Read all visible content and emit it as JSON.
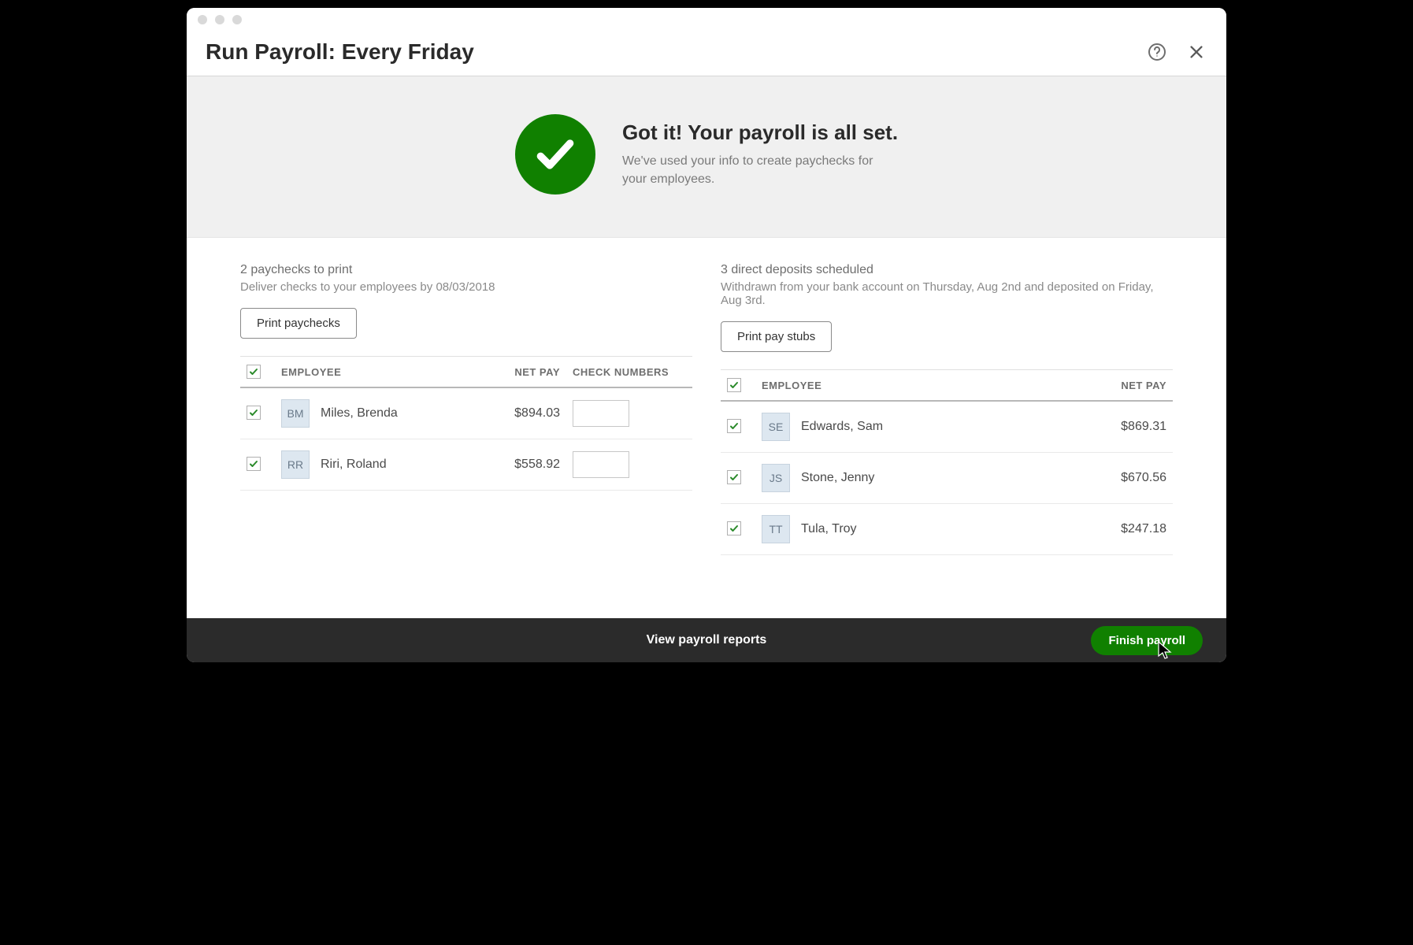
{
  "header": {
    "title": "Run Payroll: Every Friday"
  },
  "hero": {
    "heading": "Got it! Your payroll is all set.",
    "sub": "We've used your info to create paychecks for your employees."
  },
  "left": {
    "title": "2 paychecks to print",
    "sub": "Deliver checks to your employees by 08/03/2018",
    "button": "Print paychecks",
    "columns": {
      "employee": "EMPLOYEE",
      "netpay": "NET PAY",
      "checknums": "CHECK NUMBERS"
    },
    "rows": [
      {
        "initials": "BM",
        "name": "Miles, Brenda",
        "netpay": "$894.03",
        "checknum": ""
      },
      {
        "initials": "RR",
        "name": "Riri, Roland",
        "netpay": "$558.92",
        "checknum": ""
      }
    ]
  },
  "right": {
    "title": "3 direct deposits scheduled",
    "sub": "Withdrawn from your bank account on Thursday, Aug 2nd and deposited on Friday, Aug 3rd.",
    "button": "Print pay stubs",
    "columns": {
      "employee": "EMPLOYEE",
      "netpay": "NET PAY"
    },
    "rows": [
      {
        "initials": "SE",
        "name": "Edwards, Sam",
        "netpay": "$869.31"
      },
      {
        "initials": "JS",
        "name": "Stone, Jenny",
        "netpay": "$670.56"
      },
      {
        "initials": "TT",
        "name": "Tula, Troy",
        "netpay": "$247.18"
      }
    ]
  },
  "footer": {
    "reports_link": "View payroll reports",
    "finish_button": "Finish payroll"
  }
}
